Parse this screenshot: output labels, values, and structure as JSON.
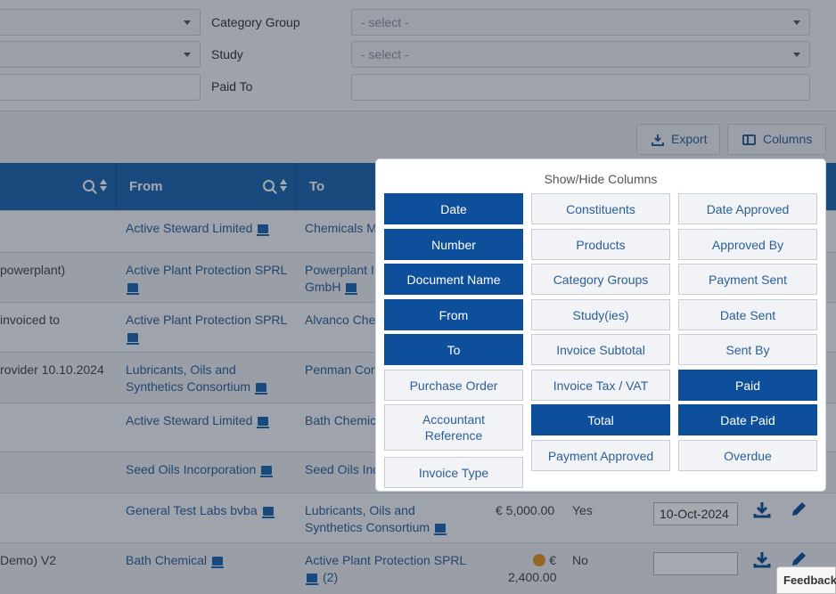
{
  "filters": {
    "category_group_label": "Category Group",
    "category_group_value": "- select -",
    "study_label": "Study",
    "study_value": "- select -",
    "paid_to_label": "Paid To",
    "paid_to_value": ""
  },
  "toolbar": {
    "export_label": "Export",
    "columns_label": "Columns"
  },
  "table": {
    "headers": [
      "From",
      "To"
    ],
    "rows": [
      {
        "doc": "",
        "from": "Active Steward Limited",
        "to": "Chemicals M"
      },
      {
        "doc": "powerplant)",
        "from": "Active Plant Protection SPRL",
        "to": "Powerplant I",
        "to2": "GmbH"
      },
      {
        "doc": " invoiced to",
        "from": "Active Plant Protection SPRL",
        "to": "Alvanco Che"
      },
      {
        "doc": "rovider 10.10.2024",
        "from": "Lubricants, Oils and",
        "from2": "Synthetics Consortium",
        "to": "Penman Cor"
      },
      {
        "doc": "",
        "from": "Active Steward Limited",
        "to": "Bath Chemic"
      },
      {
        "doc": "",
        "from": "Seed Oils Incorporation",
        "to": "Seed Oils Inc"
      },
      {
        "doc": "",
        "from": "General Test Labs bvba",
        "to": "Lubricants, Oils and",
        "to2": "Synthetics Consortium",
        "total": "€ 5,000.00",
        "paid": "Yes",
        "date_paid": "10-Oct-2024"
      },
      {
        "doc": "Demo) V2",
        "from": "Bath Chemical",
        "to": "Active Plant Protection SPRL",
        "to2": "(2)",
        "total": "€",
        "total2": "2,400.00",
        "paid": "No",
        "date_paid": ""
      }
    ]
  },
  "popup": {
    "title": "Show/Hide Columns",
    "columns": [
      {
        "label": "Date",
        "on": true
      },
      {
        "label": "Constituents",
        "on": false
      },
      {
        "label": "Date Approved",
        "on": false
      },
      {
        "label": "Number",
        "on": true
      },
      {
        "label": "Products",
        "on": false
      },
      {
        "label": "Approved By",
        "on": false
      },
      {
        "label": "Document Name",
        "on": true
      },
      {
        "label": "Category Groups",
        "on": false
      },
      {
        "label": "Payment Sent",
        "on": false
      },
      {
        "label": "From",
        "on": true
      },
      {
        "label": "Study(ies)",
        "on": false
      },
      {
        "label": "Date Sent",
        "on": false
      },
      {
        "label": "To",
        "on": true
      },
      {
        "label": "Invoice Subtotal",
        "on": false
      },
      {
        "label": "Sent By",
        "on": false
      },
      {
        "label": "Purchase Order",
        "on": false
      },
      {
        "label": "Invoice Tax / VAT",
        "on": false
      },
      {
        "label": "Paid",
        "on": true
      },
      {
        "label": "Accountant Reference",
        "on": false
      },
      {
        "label": "Total",
        "on": true
      },
      {
        "label": "Date Paid",
        "on": true
      },
      {
        "label": "Invoice Type",
        "on": false
      },
      {
        "label": "Payment Approved",
        "on": false
      },
      {
        "label": "Overdue",
        "on": false
      }
    ]
  },
  "feedback_label": "Feedback",
  "colors": {
    "primary": "#1a67b0",
    "active": "#0e4f9c",
    "link": "#2b5f96",
    "clock": "#e3941d"
  }
}
